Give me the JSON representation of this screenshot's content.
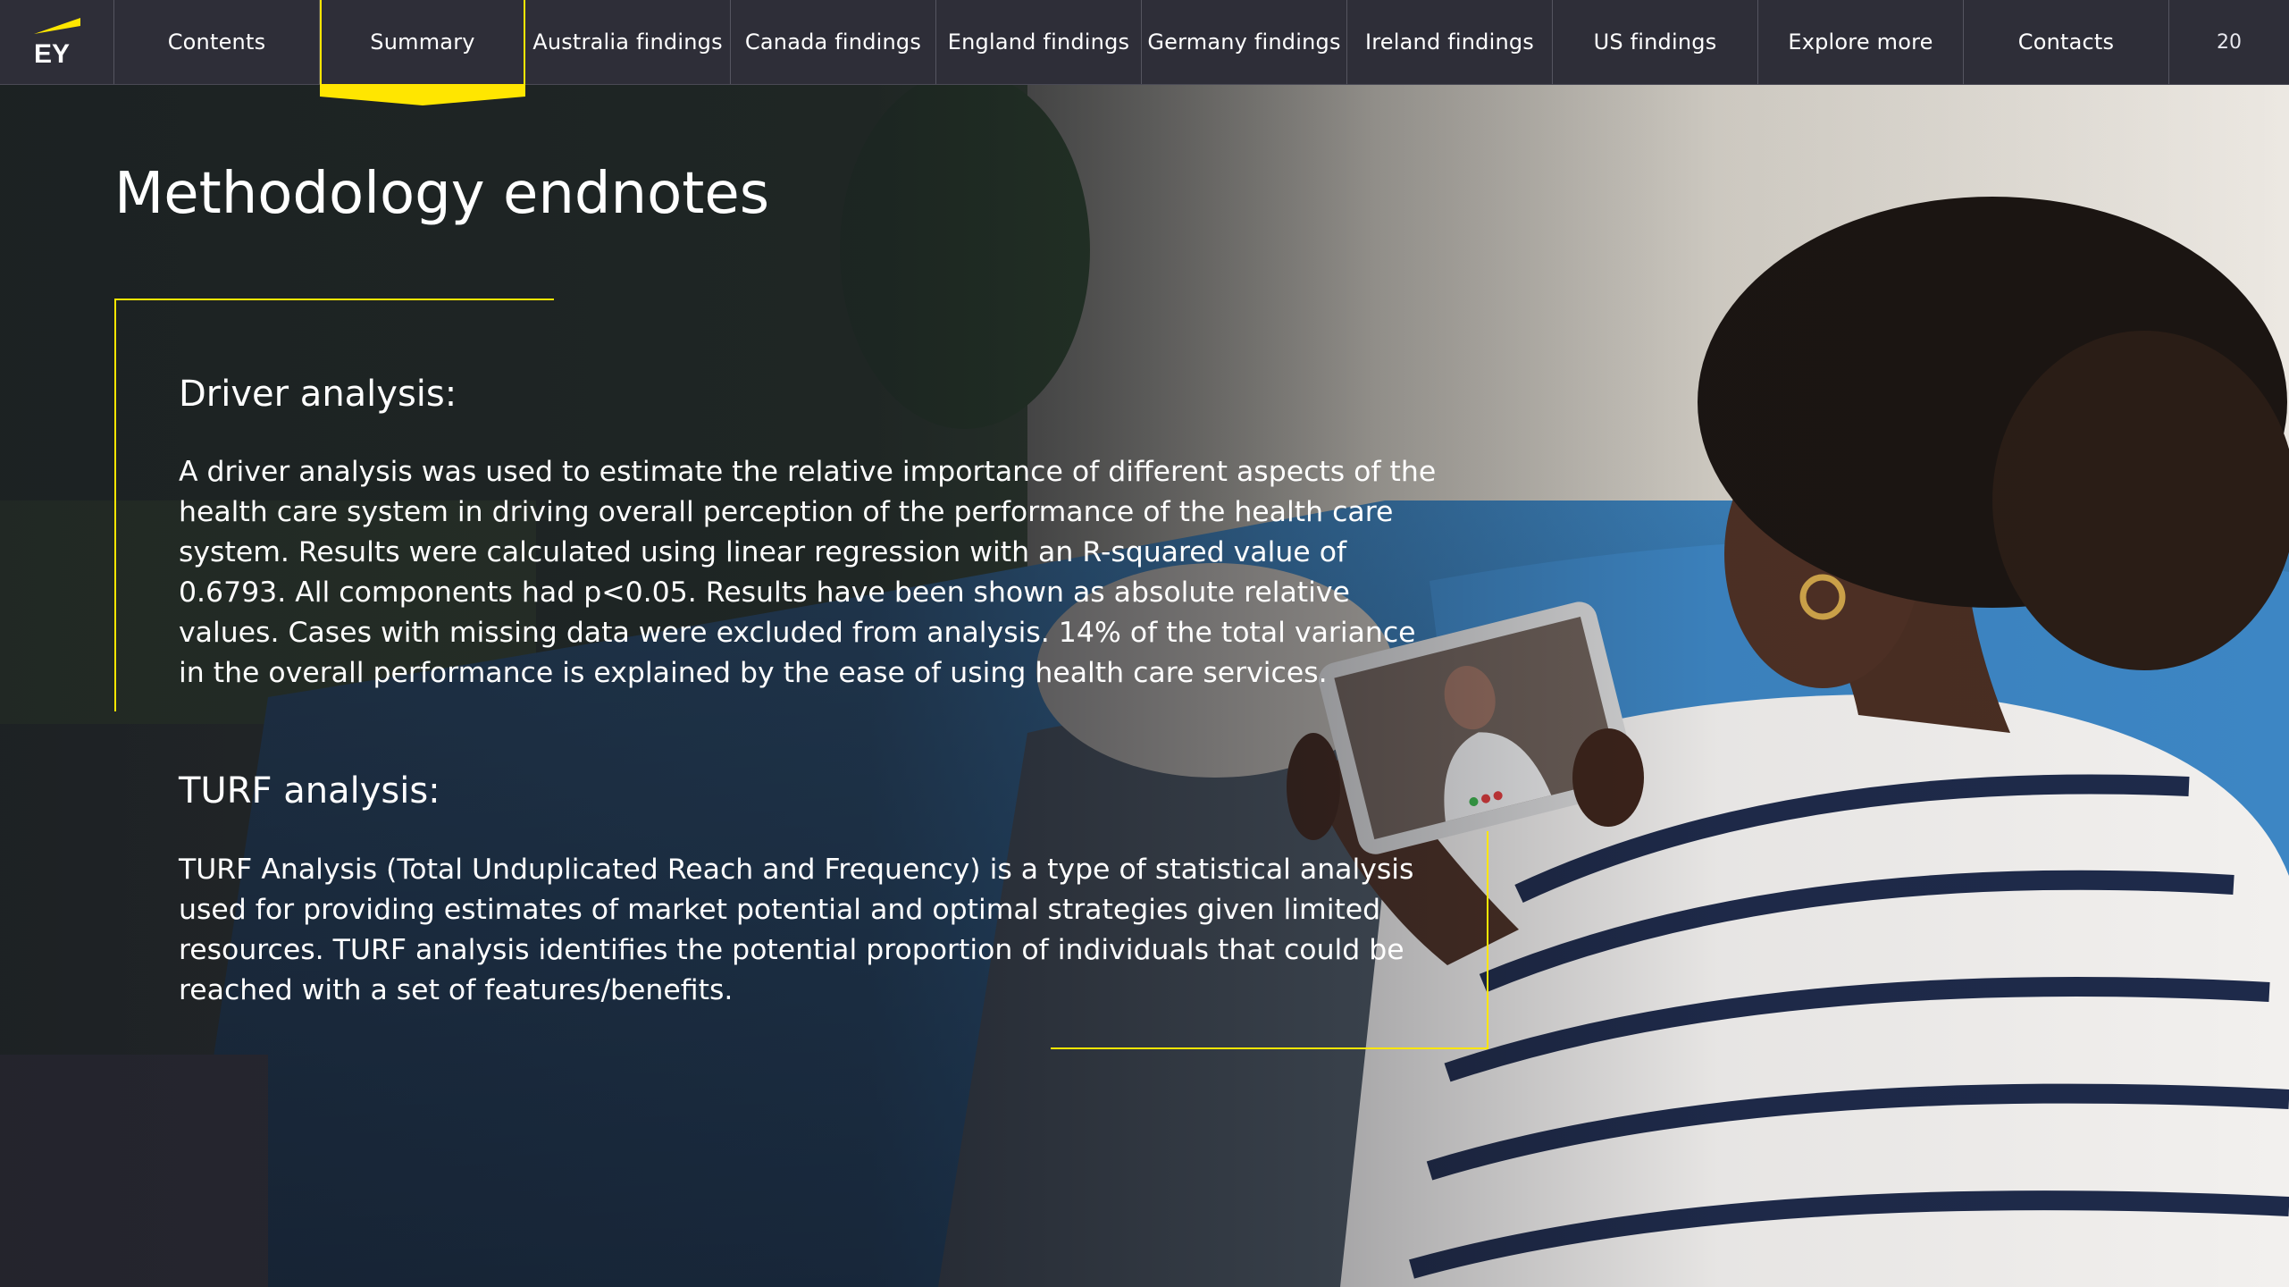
{
  "brand": {
    "logo_text": "EY",
    "accent_color": "#ffe600",
    "nav_bg": "#2e2e38"
  },
  "nav": {
    "items": [
      {
        "label": "Contents"
      },
      {
        "label": "Summary",
        "active": true
      },
      {
        "label": "Australia findings"
      },
      {
        "label": "Canada findings"
      },
      {
        "label": "England findings"
      },
      {
        "label": "Germany findings"
      },
      {
        "label": "Ireland findings"
      },
      {
        "label": "US findings"
      },
      {
        "label": "Explore more"
      },
      {
        "label": "Contacts"
      }
    ],
    "page_number": "20"
  },
  "page": {
    "title": "Methodology endnotes"
  },
  "sections": {
    "driver": {
      "heading": "Driver analysis:",
      "body": "A driver analysis was used to estimate the relative importance of different aspects of the health care system in driving overall perception of the performance of the health care system. Results were calculated using linear regression with an R-squared value of 0.6793. All components had p<0.05. Results have been shown as absolute relative values. Cases with missing data were excluded from analysis. 14% of the total variance in the overall performance is explained by the ease of using health care services."
    },
    "turf": {
      "heading": "TURF analysis:",
      "body": "TURF Analysis (Total Unduplicated Reach and Frequency) is a type of statistical analysis used for providing estimates of market potential and optimal strategies given limited resources. TURF analysis identifies the potential proportion of individuals that could be reached with a set of features/benefits."
    }
  }
}
